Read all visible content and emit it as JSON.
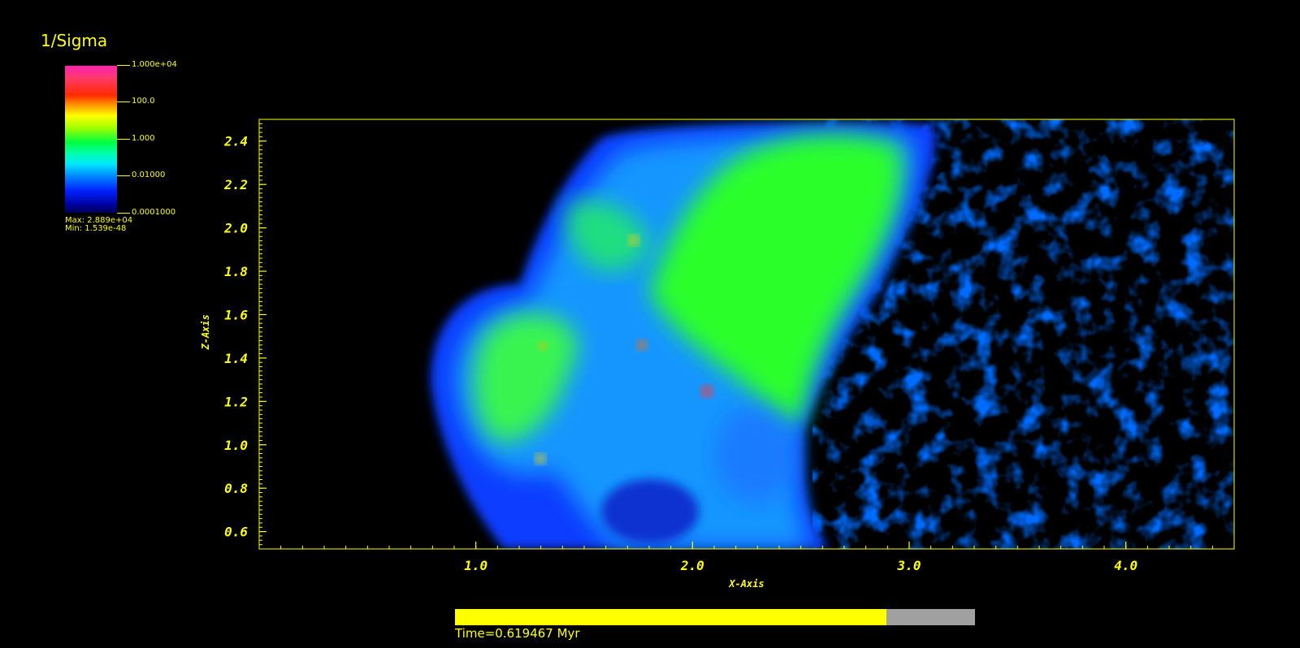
{
  "legend": {
    "title": "1/Sigma",
    "ticks": [
      "1.000e+04",
      "100.0",
      "1.000",
      "0.01000",
      "0.0001000"
    ],
    "max_label": "Max:  2.889e+04",
    "min_label": "Min:  1.539e-48"
  },
  "progress": {
    "fraction": 0.83,
    "time_label": "Time=0.619467 Myr"
  },
  "chart_data": {
    "type": "heatmap",
    "title": "",
    "xlabel": "X-Axis",
    "ylabel": "Z-Axis",
    "xlim": [
      0.0,
      4.5
    ],
    "ylim": [
      0.52,
      2.5
    ],
    "x_ticks": [
      1.0,
      2.0,
      3.0,
      4.0
    ],
    "x_tick_labels": [
      "1.0",
      "2.0",
      "3.0",
      "4.0"
    ],
    "y_ticks": [
      0.6,
      0.8,
      1.0,
      1.2,
      1.4,
      1.6,
      1.8,
      2.0,
      2.2,
      2.4
    ],
    "y_tick_labels": [
      "0.6",
      "0.8",
      "1.0",
      "1.2",
      "1.4",
      "1.6",
      "1.8",
      "2.0",
      "2.2",
      "2.4"
    ],
    "colorbar": {
      "variable": "1/Sigma",
      "scale": "log",
      "range": [
        0.0001,
        10000
      ]
    },
    "grid": false
  },
  "colors": {
    "axis": "#ffff00",
    "background": "#000000",
    "progress_fill": "#ffff00",
    "progress_track": "#a0a0a0"
  }
}
